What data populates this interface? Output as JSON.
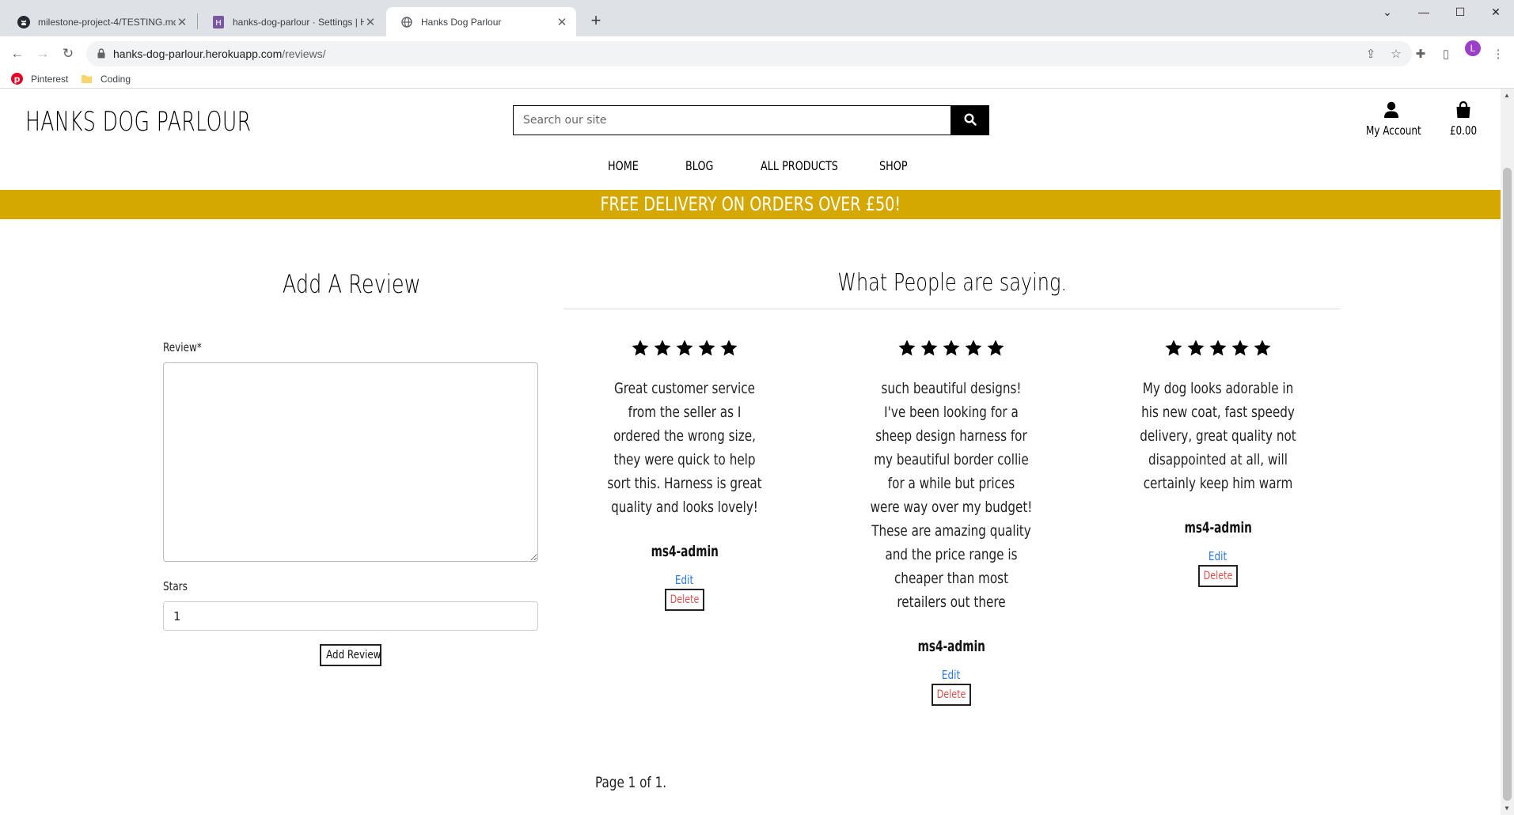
{
  "browser": {
    "tabs": [
      {
        "title": "milestone-project-4/TESTING.md",
        "icon": "github-icon",
        "active": false
      },
      {
        "title": "hanks-dog-parlour · Settings | He",
        "icon": "heroku-icon",
        "active": false
      },
      {
        "title": "Hanks Dog Parlour",
        "icon": "globe-icon",
        "active": true
      }
    ],
    "url_host": "hanks-dog-parlour.herokuapp.com",
    "url_path": "/reviews/",
    "profile_initial": "L",
    "bookmarks": [
      {
        "label": "Pinterest",
        "icon": "pinterest-icon"
      },
      {
        "label": "Coding",
        "icon": "folder-icon"
      }
    ]
  },
  "site": {
    "logo": "HANKS DOG PARLOUR",
    "search_placeholder": "Search our site",
    "account_label": "My Account",
    "bag_total": "£0.00",
    "nav": [
      "HOME",
      "BLOG",
      "ALL PRODUCTS",
      "SHOP"
    ],
    "banner": "FREE DELIVERY ON ORDERS OVER £50!",
    "brand_color": "#d4a800"
  },
  "form": {
    "title": "Add A Review",
    "review_label": "Review*",
    "review_value": "",
    "stars_label": "Stars",
    "stars_value": "1",
    "submit_label": "Add Review"
  },
  "reviews": {
    "title": "What People are saying.",
    "items": [
      {
        "rating": 5,
        "lines": [
          "Great customer service",
          "from the seller as I",
          "ordered the wrong size,",
          "they were quick to help",
          "sort this. Harness is great",
          "quality and looks lovely!"
        ],
        "author": "ms4-admin",
        "edit_label": "Edit",
        "delete_label": "Delete"
      },
      {
        "rating": 5,
        "lines": [
          "such beautiful designs!",
          "I've been looking for a",
          "sheep design harness for",
          "my beautiful border collie",
          "for a while but prices",
          "were way over my budget!",
          "These are amazing quality",
          "and the price range is",
          "cheaper than most",
          "retailers out there"
        ],
        "author": "ms4-admin",
        "edit_label": "Edit",
        "delete_label": "Delete"
      },
      {
        "rating": 5,
        "lines": [
          "My dog looks adorable in",
          "his new coat, fast speedy",
          "delivery, great quality not",
          "disappointed at all, will",
          "certainly keep him warm"
        ],
        "author": "ms4-admin",
        "edit_label": "Edit",
        "delete_label": "Delete"
      }
    ],
    "pagination": "Page 1 of 1."
  }
}
